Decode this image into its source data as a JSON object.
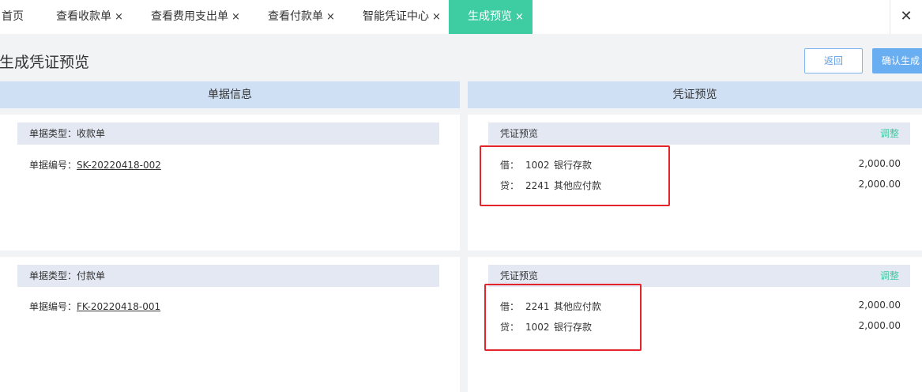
{
  "tabs": [
    {
      "label": "首页",
      "closable": false
    },
    {
      "label": "查看收款单",
      "closable": true
    },
    {
      "label": "查看费用支出单",
      "closable": true
    },
    {
      "label": "查看付款单",
      "closable": true
    },
    {
      "label": "智能凭证中心",
      "closable": true
    },
    {
      "label": "生成预览",
      "closable": true,
      "active": true
    }
  ],
  "tab_close_glyph": "×",
  "tabbar_close_glyph": "✕",
  "page": {
    "title": "生成凭证预览",
    "back_label": "返回",
    "confirm_label": "确认生成"
  },
  "sections": {
    "left_title": "单据信息",
    "right_title": "凭证预览"
  },
  "documents": [
    {
      "type_text": "单据类型：收款单",
      "number_label": "单据编号：",
      "number_value": "SK-20220418-002",
      "voucher_title": "凭证预览",
      "adjust_label": "调整",
      "entries": [
        {
          "direction": "借：",
          "code": "1002",
          "account": "银行存款",
          "amount": "2,000.00"
        },
        {
          "direction": "贷：",
          "code": "2241",
          "account": "其他应付款",
          "amount": "2,000.00"
        }
      ]
    },
    {
      "type_text": "单据类型：付款单",
      "number_label": "单据编号：",
      "number_value": "FK-20220418-001",
      "voucher_title": "凭证预览",
      "adjust_label": "调整",
      "entries": [
        {
          "direction": "借：",
          "code": "2241",
          "account": "其他应付款",
          "amount": "2,000.00"
        },
        {
          "direction": "贷：",
          "code": "1002",
          "account": "银行存款",
          "amount": "2,000.00"
        }
      ]
    }
  ],
  "colors": {
    "accent": "#3ecca3",
    "primary": "#6aaef2",
    "section_header": "#cfe0f4",
    "highlight_box": "#e3242b"
  }
}
